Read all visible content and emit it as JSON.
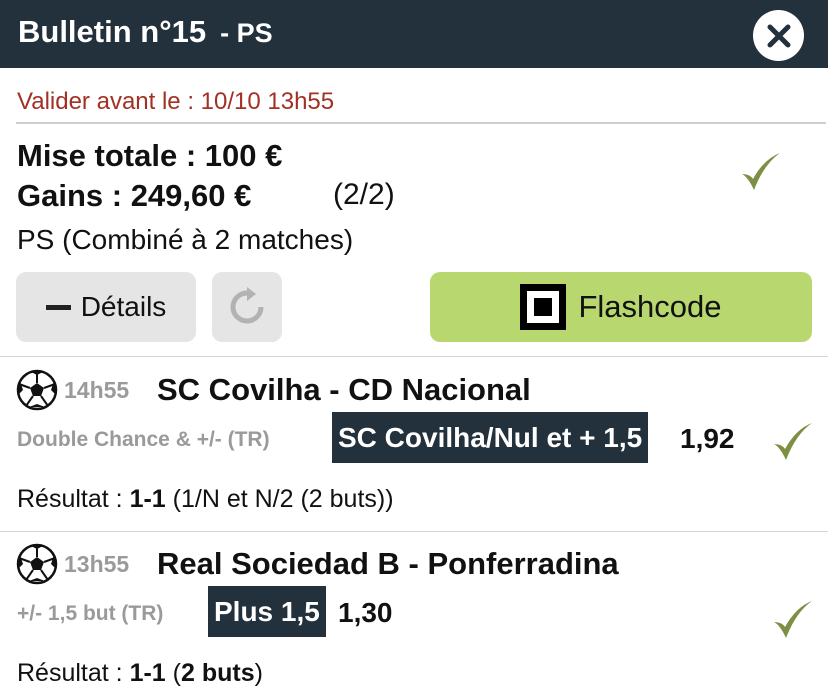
{
  "header": {
    "title": "Bulletin n°15",
    "subtitle": "- PS"
  },
  "summary": {
    "validate_text": "Valider avant le : 10/10 13h55",
    "mise_label": "Mise totale : 100 €",
    "gains_label": "Gains : 249,60 €",
    "gains_count": "(2/2)",
    "bet_type": "PS (Combiné à 2 matches)"
  },
  "buttons": {
    "details_label": "Détails",
    "flashcode_label": "Flashcode"
  },
  "matches": [
    {
      "time": "14h55",
      "title": "SC Covilha - CD Nacional",
      "market": "Double Chance & +/- (TR)",
      "selection": "SC Covilha/Nul et + 1,5",
      "odds": "1,92",
      "result_label": "Résultat :",
      "result_score": "1-1",
      "result_detail": "(1/N et N/2 (2 buts))"
    },
    {
      "time": "13h55",
      "title": "Real Sociedad B - Ponferradina",
      "market": "+/- 1,5 but (TR)",
      "selection": "Plus 1,5",
      "odds": "1,30",
      "result_label": "Résultat :",
      "result_score": "1-1",
      "result_detail_open": "(",
      "result_detail_bold": "2 buts",
      "result_detail_close": ")"
    }
  ],
  "colors": {
    "header_bg": "#23313d",
    "check_green": "#7d8f42",
    "flash_bg": "#b8d86f",
    "deadline_red": "#a23024"
  },
  "icons": {
    "close": "close-icon",
    "check": "check-icon",
    "refresh": "refresh-icon",
    "ball": "soccer-ball-icon",
    "qr": "qr-code-icon",
    "minus": "minus-icon"
  }
}
